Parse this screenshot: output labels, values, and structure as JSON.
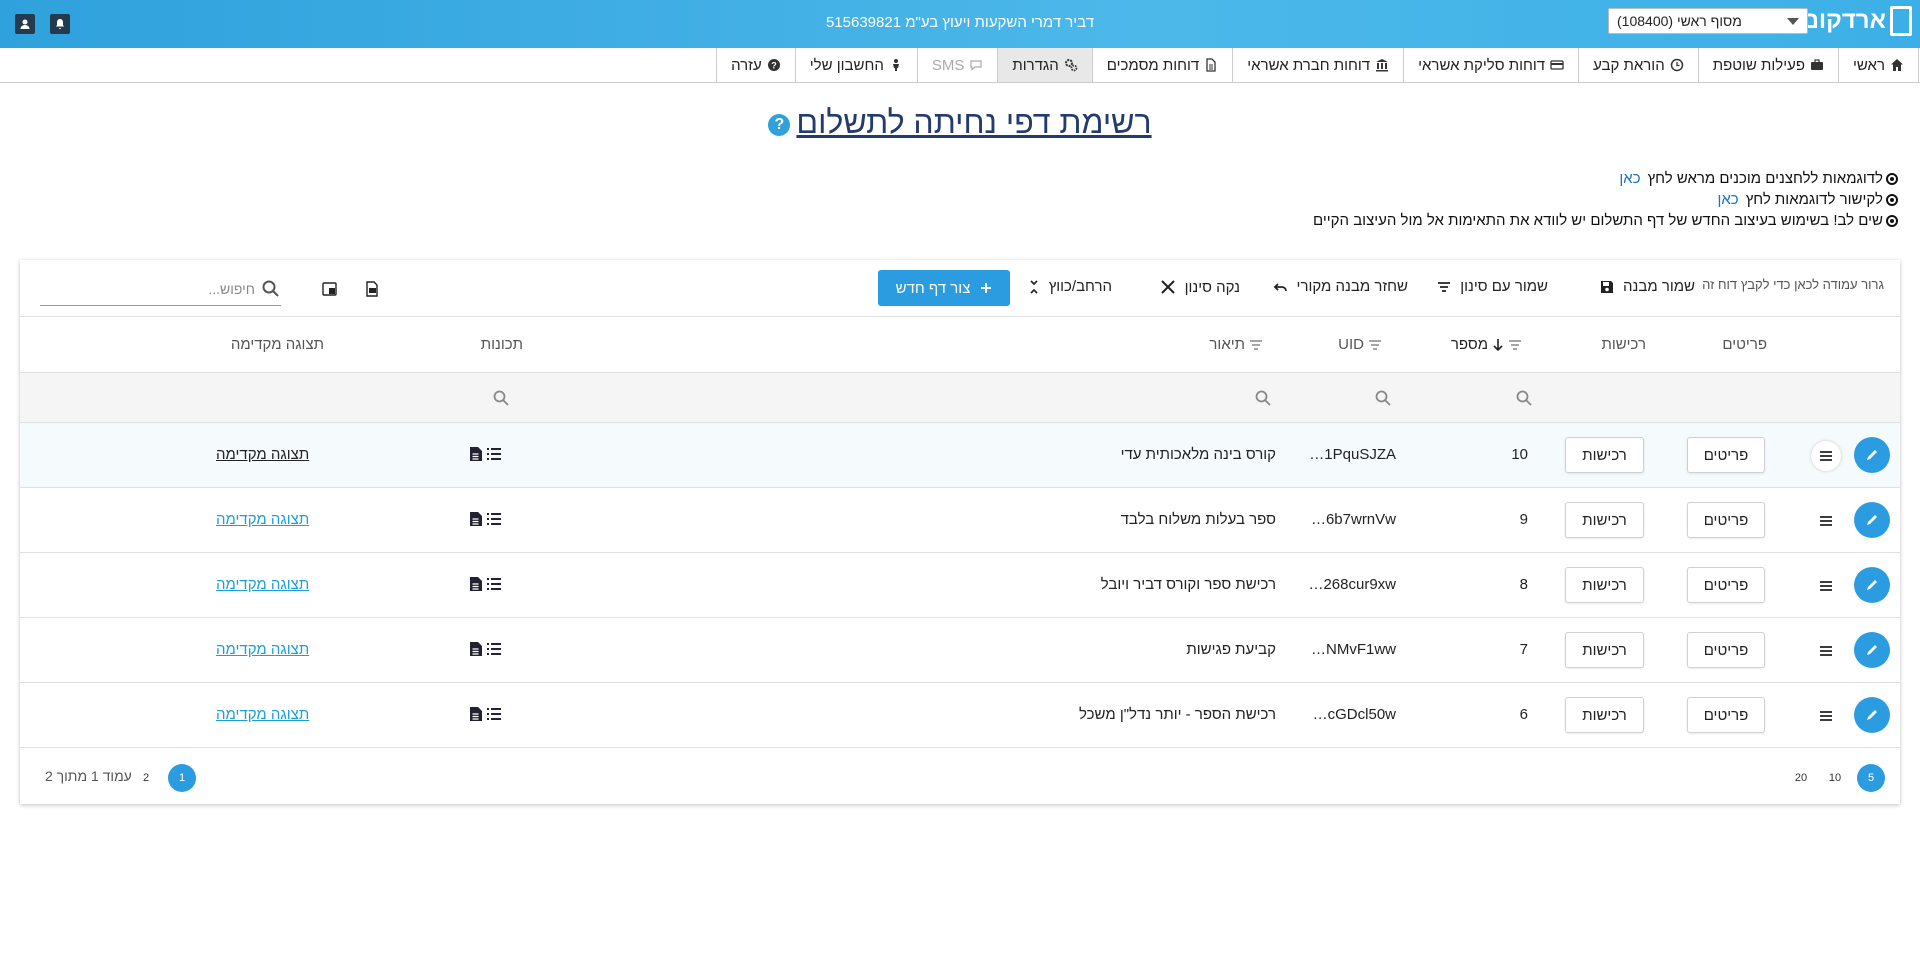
{
  "header": {
    "logo": "ארדקום",
    "branch_select": "מסוף ראשי (108400)",
    "company": "דביר דמרי השקעות ויעוץ בע\"מ 515639821"
  },
  "nav": [
    {
      "label": "ראשי",
      "icon": "home-icon"
    },
    {
      "label": "פעילות שוטפת",
      "icon": "briefcase-icon"
    },
    {
      "label": "הוראת קבע",
      "icon": "clock-icon"
    },
    {
      "label": "דוחות סליקת אשראי",
      "icon": "credit-card-icon"
    },
    {
      "label": "דוחות חברת אשראי",
      "icon": "bank-icon"
    },
    {
      "label": "דוחות מסמכים",
      "icon": "document-icon"
    },
    {
      "label": "הגדרות",
      "icon": "gears-icon",
      "active": true
    },
    {
      "label": "SMS",
      "icon": "chat-icon",
      "disabled": true
    },
    {
      "label": "החשבון שלי",
      "icon": "user-icon"
    },
    {
      "label": "עזרה",
      "icon": "question-icon"
    }
  ],
  "page": {
    "title": "רשימת דפי נחיתה לתשלום",
    "help": "?",
    "notes": [
      {
        "text": "לדוגמאות ללחצנים מוכנים מראש לחץ",
        "link": "כאן"
      },
      {
        "text": "לקישור לדוגמאות לחץ",
        "link": "כאן"
      },
      {
        "text": "שים לב! בשימוש בעיצוב החדש של דף התשלום יש לוודא את התאימות אל מול העיצוב הקיים",
        "link": ""
      }
    ]
  },
  "toolbar": {
    "drag_hint": "גרור עמודה לכאן כדי לקבץ דוח זה",
    "save_layout": "שמור מבנה",
    "save_filter": "שמור עם סינון",
    "restore_layout": "שחזר מבנה מקורי",
    "clear_filter": "נקה סינון",
    "expand_collapse": "הרחב/כווץ",
    "new_page": "צור דף חדש",
    "search_placeholder": "חיפוש..."
  },
  "columns": {
    "details": "פריטים",
    "purchases": "רכישות",
    "number": "מספר",
    "uid": "UID",
    "description": "תיאור",
    "properties": "תכונות",
    "preview": "תצוגה מקדימה"
  },
  "rows": [
    {
      "details_btn": "פריטים",
      "purchases_btn": "רכישות",
      "number": "10",
      "uid": "1PquSJZA…",
      "description": "קורס בינה מלאכותית עדי",
      "preview": "תצוגה מקדימה"
    },
    {
      "details_btn": "פריטים",
      "purchases_btn": "רכישות",
      "number": "9",
      "uid": "6b7wrnVw…",
      "description": "ספר בעלות משלוח בלבד",
      "preview": "תצוגה מקדימה"
    },
    {
      "details_btn": "פריטים",
      "purchases_btn": "רכישות",
      "number": "8",
      "uid": "268cur9xw…",
      "description": "רכישת ספר וקורס דביר ויובל",
      "preview": "תצוגה מקדימה"
    },
    {
      "details_btn": "פריטים",
      "purchases_btn": "רכישות",
      "number": "7",
      "uid": "NMvF1ww…",
      "description": "קביעת פגישות",
      "preview": "תצוגה מקדימה"
    },
    {
      "details_btn": "פריטים",
      "purchases_btn": "רכישות",
      "number": "6",
      "uid": "cGDcl50w…",
      "description": "רכישת הספר - יותר נדל\"ן משכל",
      "preview": "תצוגה מקדימה"
    }
  ],
  "pagination": {
    "page_sizes": [
      "5",
      "10",
      "20"
    ],
    "active_size": "5",
    "pages": [
      "1",
      "2"
    ],
    "active_page": "1",
    "info": "עמוד 1 מתוך 2"
  },
  "colors": {
    "accent": "#2c9ce0",
    "header_gradient_start": "#2fa1dc",
    "title": "#233b6e"
  }
}
